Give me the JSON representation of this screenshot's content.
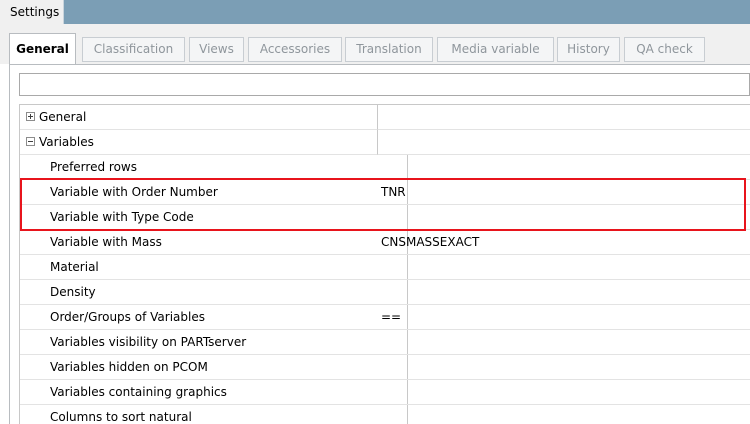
{
  "window": {
    "title": "Settings"
  },
  "tabs": [
    {
      "label": "General",
      "active": true
    },
    {
      "label": "Classification",
      "active": false
    },
    {
      "label": "Views",
      "active": false
    },
    {
      "label": "Accessories",
      "active": false
    },
    {
      "label": "Translation",
      "active": false
    },
    {
      "label": "Media variable",
      "active": false
    },
    {
      "label": "History",
      "active": false
    },
    {
      "label": "QA check",
      "active": false
    }
  ],
  "filter": {
    "value": "",
    "placeholder": ""
  },
  "groups": {
    "general": {
      "label": "General",
      "expanded": false,
      "icon": "expand-plus-icon"
    },
    "variables": {
      "label": "Variables",
      "expanded": true,
      "icon": "collapse-minus-icon"
    }
  },
  "properties": [
    {
      "name": "Preferred rows",
      "value": ""
    },
    {
      "name": "Variable with Order Number",
      "value": "TNR"
    },
    {
      "name": "Variable with Type Code",
      "value": ""
    },
    {
      "name": "Variable with Mass",
      "value": "CNSMASSEXACT"
    },
    {
      "name": "Material",
      "value": ""
    },
    {
      "name": "Density",
      "value": ""
    },
    {
      "name": "Order/Groups of Variables",
      "value": "=="
    },
    {
      "name": "Variables visibility on PARTserver",
      "value": ""
    },
    {
      "name": "Variables hidden on PCOM",
      "value": ""
    },
    {
      "name": "Variables containing graphics",
      "value": ""
    },
    {
      "name": "Columns to sort natural",
      "value": ""
    }
  ],
  "colors": {
    "titlebar": "#7b9eb5",
    "highlight": "#e8141c",
    "grid_line": "#c8c8c8"
  }
}
